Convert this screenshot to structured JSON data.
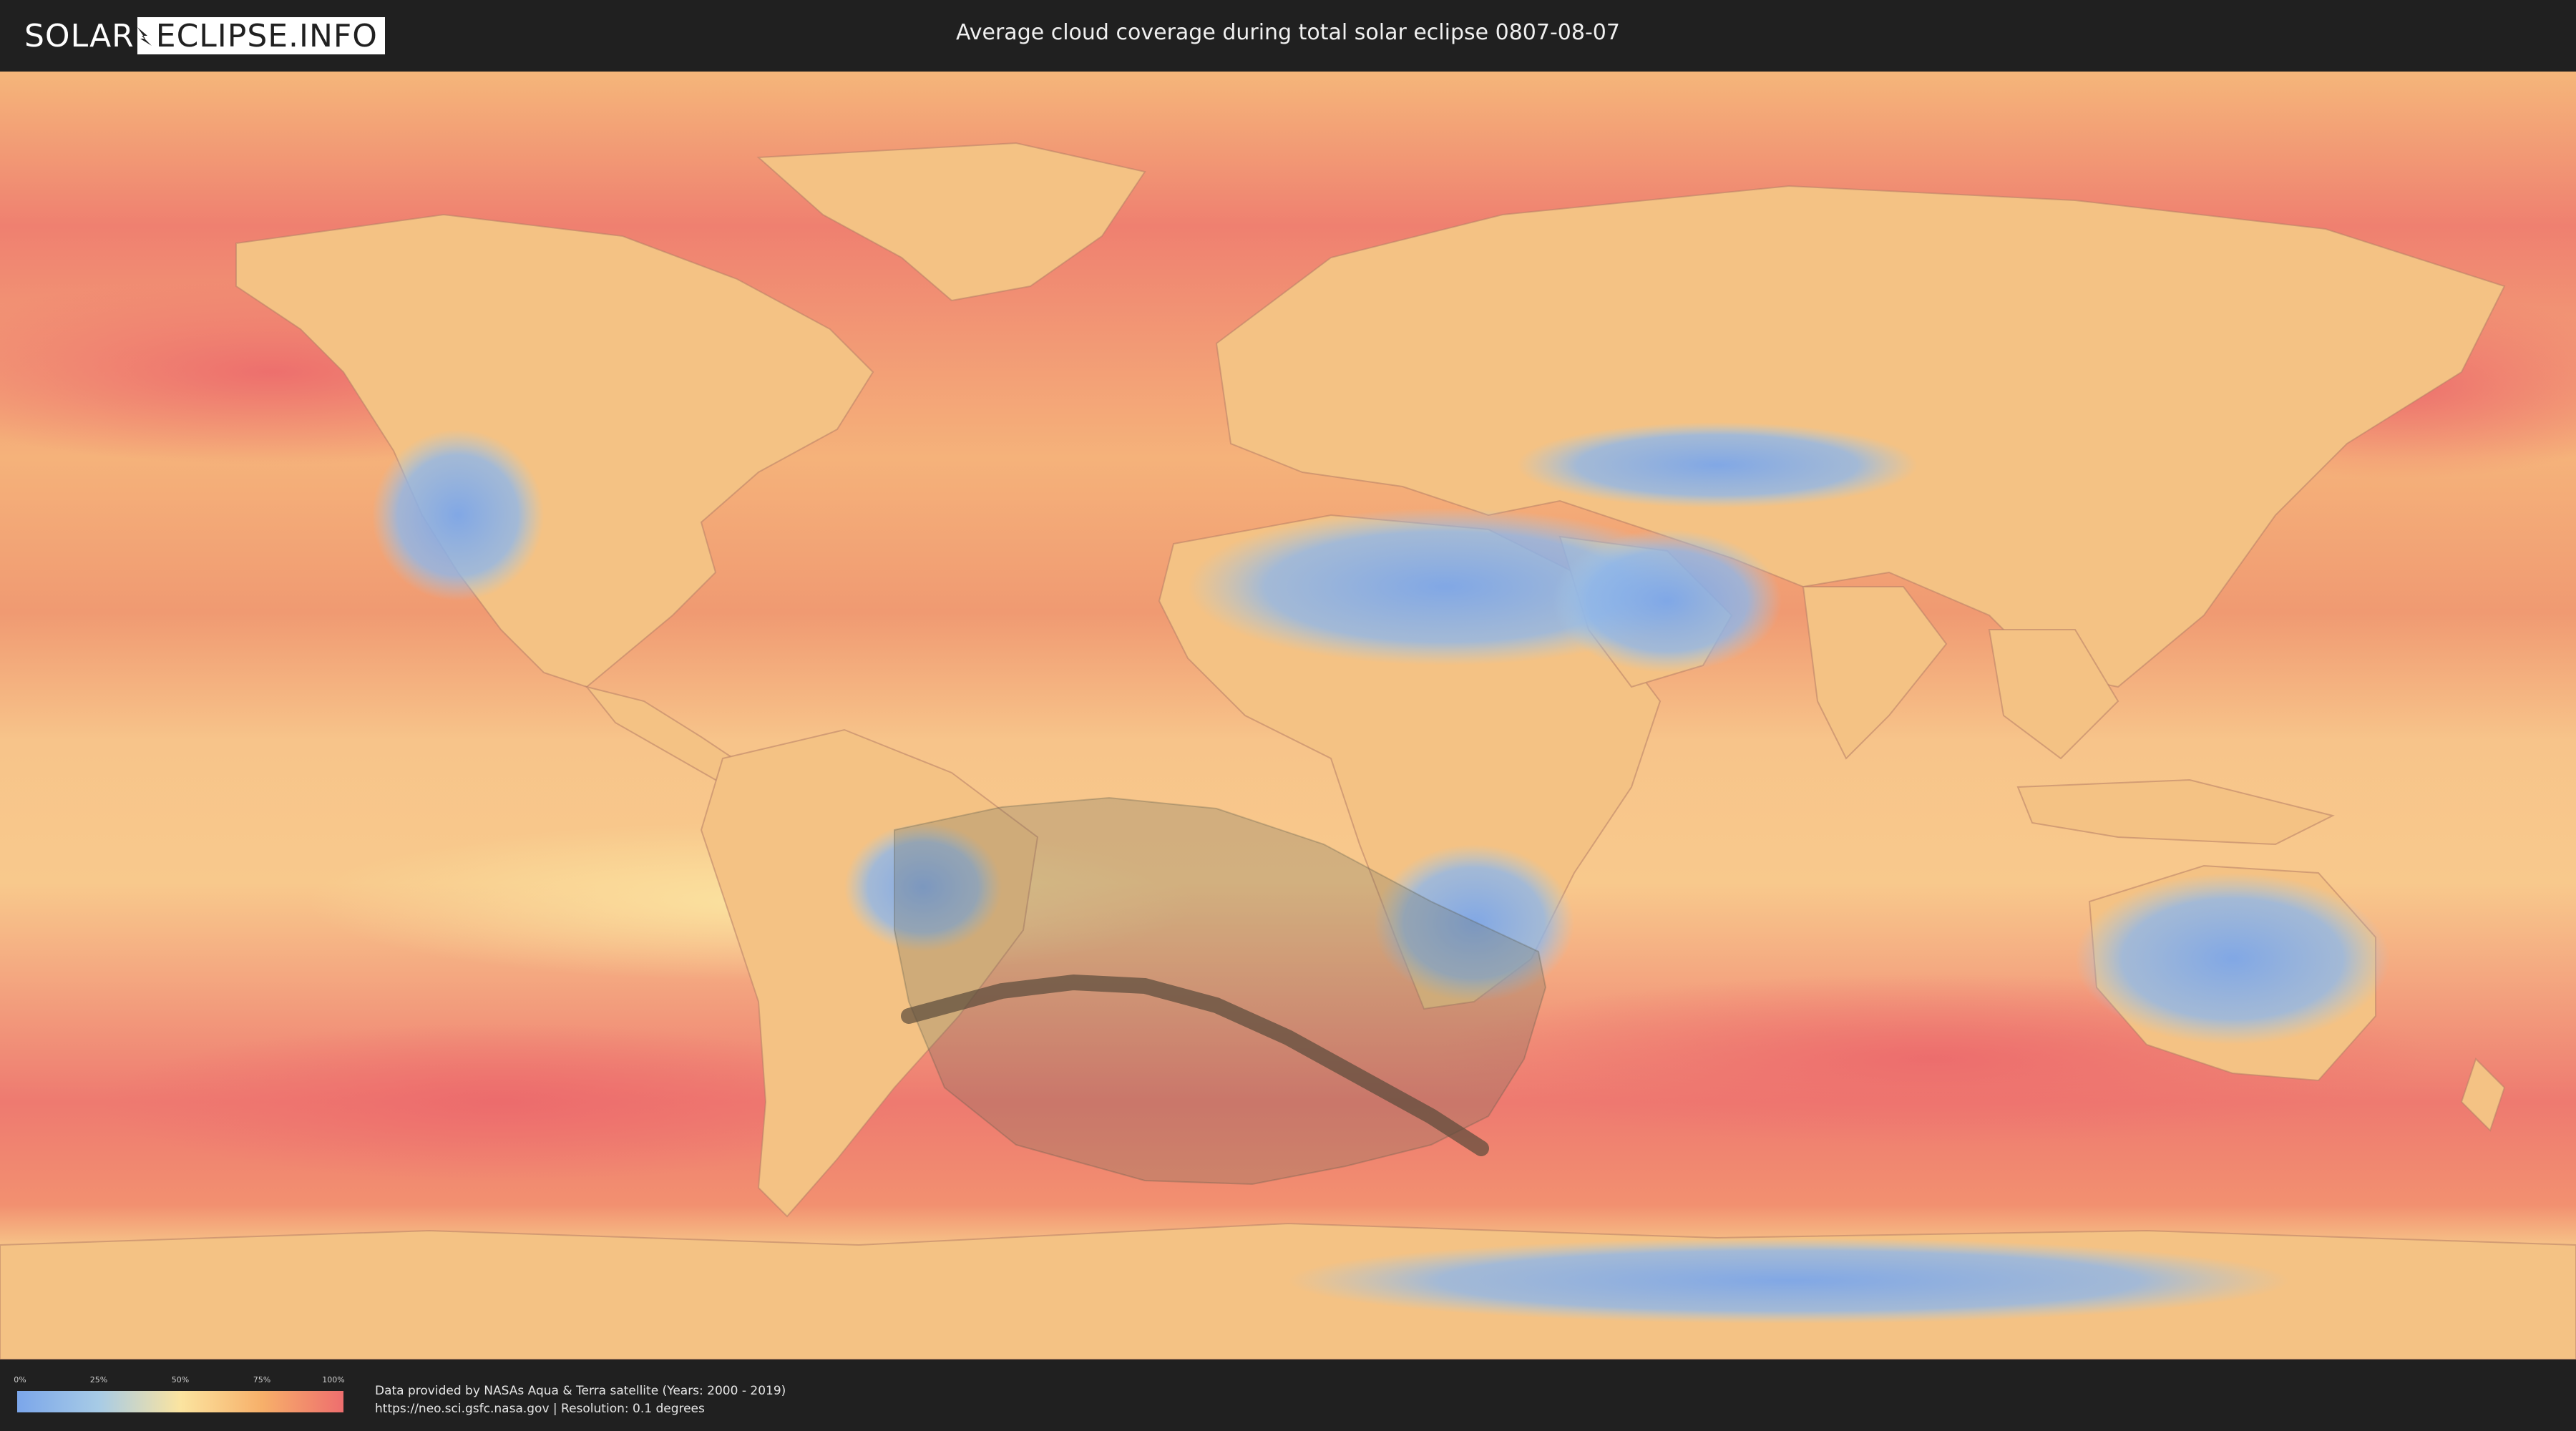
{
  "header": {
    "logo_left": "SOLAR",
    "logo_right": "ECLIPSE.INFO",
    "title": "Average cloud coverage during total solar eclipse 0807-08-07"
  },
  "map": {
    "eclipse_path_center": [
      [
        -53,
        -42
      ],
      [
        -40,
        -38.5
      ],
      [
        -30,
        -37.3
      ],
      [
        -20,
        -37.8
      ],
      [
        -10,
        -40.5
      ],
      [
        0,
        -45
      ],
      [
        10,
        -50.5
      ],
      [
        20,
        -56
      ],
      [
        27,
        -60.5
      ]
    ],
    "visibility_region": [
      [
        -55,
        -16
      ],
      [
        -40,
        -12.8
      ],
      [
        -25,
        -11.5
      ],
      [
        -10,
        -13
      ],
      [
        5,
        -18
      ],
      [
        20,
        -26
      ],
      [
        35,
        -33
      ],
      [
        36,
        -38
      ],
      [
        33,
        -48
      ],
      [
        28,
        -56
      ],
      [
        20,
        -60
      ],
      [
        8,
        -63
      ],
      [
        -5,
        -65.5
      ],
      [
        -20,
        -65
      ],
      [
        -38,
        -60
      ],
      [
        -48,
        -52
      ],
      [
        -53,
        -40
      ],
      [
        -55,
        -30
      ],
      [
        -55,
        -16
      ]
    ],
    "colors": {
      "clear": "#7ba6ea",
      "low": "#a7cbe6",
      "mid": "#fbe4a0",
      "high": "#f7b06a",
      "overcast": "#ee6e6e",
      "path": "#5a4a3a",
      "shadow": "#6e6e5e"
    }
  },
  "legend": {
    "ticks": [
      "0%",
      "25%",
      "50%",
      "75%",
      "100%"
    ]
  },
  "credits": {
    "line1": "Data provided by NASAs Aqua & Terra satellite (Years: 2000 - 2019)",
    "line2": "https://neo.sci.gsfc.nasa.gov | Resolution: 0.1 degrees"
  }
}
